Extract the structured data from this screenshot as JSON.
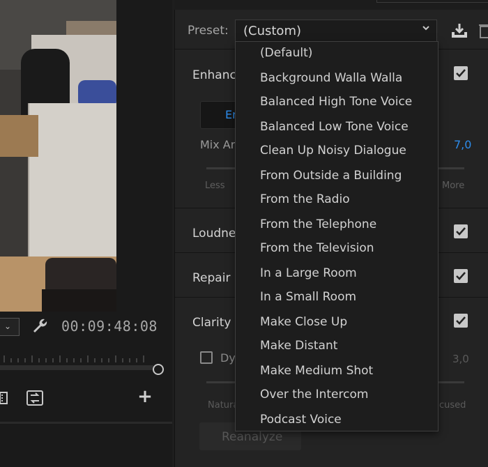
{
  "monitor": {
    "timecode": "00:09:48:08"
  },
  "panel": {
    "preset_label": "Preset:",
    "preset_value": "(Custom)",
    "sections": {
      "enhance": "Enhance",
      "enhance_button": "En",
      "mix_label": "Mix Ar",
      "mix_value": "7,0",
      "less": "Less",
      "more": "More",
      "loudness": "Loudnes",
      "repair": "Repair",
      "clarity": "Clarity",
      "dyn_label": "Dy",
      "dyn_value": "3,0",
      "natural": "Natura",
      "focused": "cused",
      "reanalyze": "Reanalyze"
    }
  },
  "dropdown": {
    "items": [
      "(Default)",
      "Background Walla Walla",
      "Balanced High Tone Voice",
      "Balanced Low Tone Voice",
      "Clean Up Noisy Dialogue",
      "From Outside a Building",
      "From the Radio",
      "From the Telephone",
      "From the Television",
      "In a Large Room",
      "In a Small Room",
      "Make Close Up",
      "Make Distant",
      "Make Medium Shot",
      "Over the Intercom",
      "Podcast Voice"
    ]
  },
  "colors": {
    "accent_blue": "#2d8ceb",
    "panel_bg": "#232323",
    "dropdown_bg": "#1d1d1d"
  },
  "icons": {
    "save": "save-preset-icon",
    "trash": "delete-preset-icon",
    "wrench": "wrench-icon",
    "loop": "loop-icon",
    "add": "add-icon",
    "chevron": "chevron-down-icon"
  }
}
